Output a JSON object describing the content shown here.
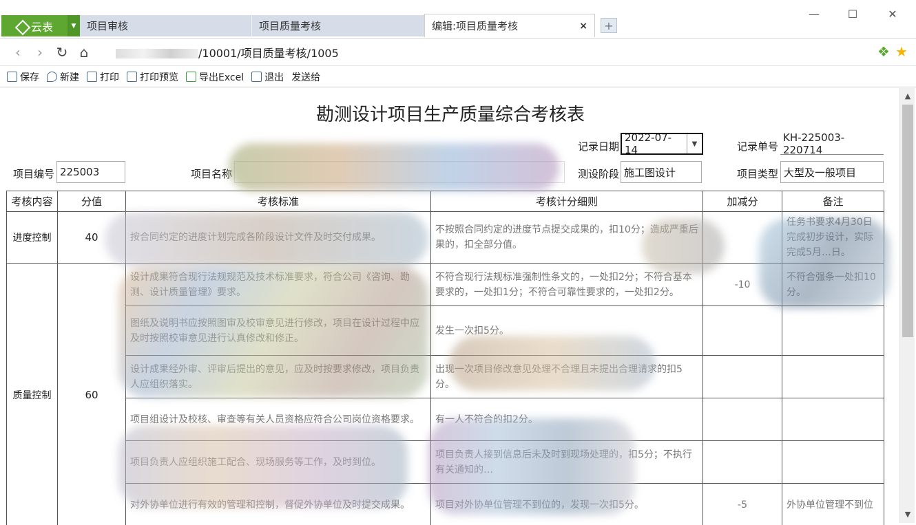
{
  "browser": {
    "brand": "云表",
    "tabs": [
      {
        "label": "项目审核"
      },
      {
        "label": "项目质量考核"
      },
      {
        "label": "编辑:项目质量考核",
        "close": "×"
      }
    ],
    "new_tab": "+",
    "window": {
      "minimize": "—",
      "maximize": "☐",
      "close": "✕"
    },
    "address": {
      "back": "‹",
      "forward": "›",
      "reload": "↻",
      "home": "⌂",
      "url_suffix": "/10001/项目质量考核/1005"
    }
  },
  "toolbar": {
    "save": "保存",
    "new": "新建",
    "print": "打印",
    "print_preview": "打印预览",
    "export_excel": "导出Excel",
    "exit": "退出",
    "send_to": "发送给"
  },
  "form": {
    "title": "勘测设计项目生产质量综合考核表",
    "record_date_label": "记录日期",
    "record_date": "2022-07-14",
    "record_no_label": "记录单号",
    "record_no": "KH-225003-220714",
    "project_no_label": "项目编号",
    "project_no": "225003",
    "project_name_label": "项目名称",
    "stage_label": "测设阶段",
    "stage": "施工图设计",
    "type_label": "项目类型",
    "type": "大型及一般项目"
  },
  "table": {
    "headers": [
      "考核内容",
      "分值",
      "考核标准",
      "考核计分细则",
      "加减分",
      "备注"
    ],
    "sections": [
      {
        "name": "进度控制",
        "score": "40"
      },
      {
        "name": "质量控制",
        "score": "60"
      }
    ],
    "rows": [
      {
        "standard": "按合同约定的进度计划完成各阶段设计文件及时交付成果。",
        "rule": "不按照合同约定的进度节点提交成果的，扣10分；造成严重后果的，扣全部分值。",
        "adjust": "",
        "note": "任务书要求4月30日完成初步设计，实际完成5月…日。"
      },
      {
        "standard": "设计成果符合现行法规规范及技术标准要求，符合公司《咨询、勘测、设计质量管理》要求。",
        "rule": "不符合现行法规标准强制性条文的，一处扣2分；不符合基本要求的，一处扣1分；不符合可靠性要求的，一处扣2分。",
        "adjust": "-10",
        "note": "不符合强条一处扣10分。"
      },
      {
        "standard": "图纸及说明书应按照图审及校审意见进行修改，项目在设计过程中应及时按照校审意见进行认真修改和修正。",
        "rule": "发生一次扣5分。",
        "adjust": "",
        "note": ""
      },
      {
        "standard": "设计成果经外审、评审后提出的意见，应及时按要求修改，项目负责人应组织落实。",
        "rule": "出现一次项目修改意见处理不合理且未提出合理请求的扣5分。",
        "adjust": "",
        "note": ""
      },
      {
        "standard": "项目组设计及校核、审查等有关人员资格应符合公司岗位资格要求。",
        "rule": "有一人不符合的扣2分。",
        "adjust": "",
        "note": ""
      },
      {
        "standard": "项目负责人应组织施工配合、现场服务等工作，及时到位。",
        "rule": "项目负责人接到信息后未及时到现场处理的，扣5分；不执行有关通知的…",
        "adjust": "",
        "note": ""
      },
      {
        "standard": "对外协单位进行有效的管理和控制，督促外协单位及时提交成果。",
        "rule": "项目对外协单位管理不到位的，发现一次扣5分。",
        "adjust": "-5",
        "note": "外协单位管理不到位"
      }
    ]
  }
}
